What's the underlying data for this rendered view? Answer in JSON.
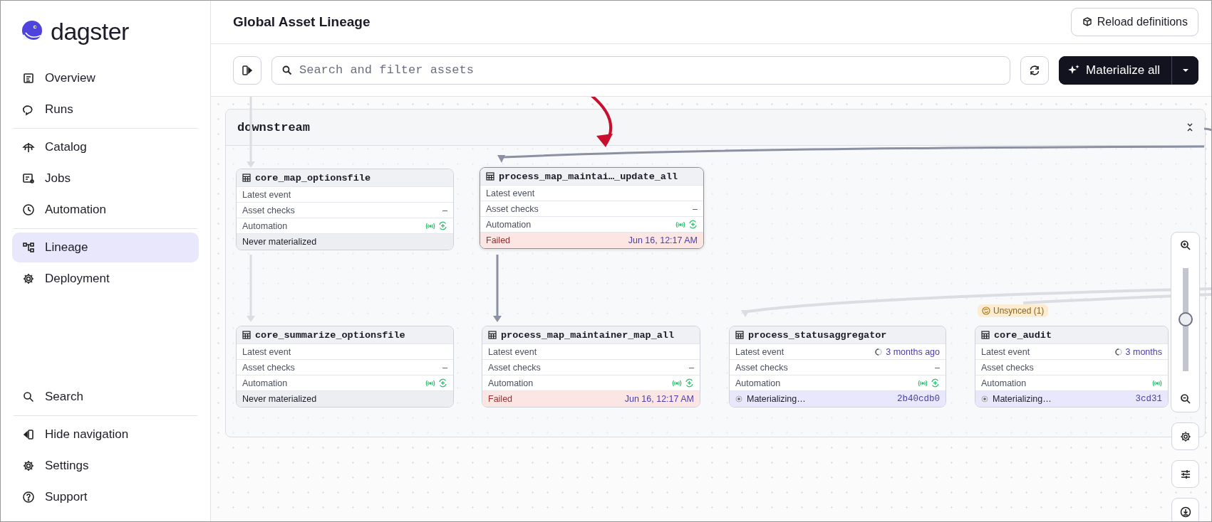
{
  "sidebar": {
    "logo": "dagster",
    "groups": [
      [
        {
          "label": "Overview",
          "selected": false
        },
        {
          "label": "Runs",
          "selected": false
        }
      ],
      [
        {
          "label": "Catalog",
          "selected": false
        },
        {
          "label": "Jobs",
          "selected": false
        },
        {
          "label": "Automation",
          "selected": false
        }
      ],
      [
        {
          "label": "Lineage",
          "selected": true
        },
        {
          "label": "Deployment",
          "selected": false
        }
      ]
    ],
    "bottom_groups": [
      [
        {
          "label": "Search",
          "selected": false
        }
      ],
      [
        {
          "label": "Hide navigation",
          "selected": false
        },
        {
          "label": "Settings",
          "selected": false
        },
        {
          "label": "Support",
          "selected": false
        }
      ]
    ]
  },
  "header": {
    "title": "Global Asset Lineage",
    "reload_button": "Reload definitions"
  },
  "toolbar": {
    "search": {
      "placeholder": "Search and filter assets"
    },
    "materialize_button": "Materialize all"
  },
  "group": {
    "title": "downstream"
  },
  "nodes": [
    {
      "name": "core_map_optionsfile",
      "selected": false,
      "rows": [
        {
          "kind": "event",
          "label": "Latest event"
        },
        {
          "kind": "checks",
          "label": "Asset checks",
          "value": "–"
        },
        {
          "kind": "automation",
          "label": "Automation",
          "icons": [
            {
              "kind": "sensor"
            },
            {
              "kind": "schedule"
            }
          ]
        }
      ],
      "status": {
        "kind": "never",
        "text": "Never materialized"
      }
    },
    {
      "name": "process_map_maintai…_update_all",
      "selected": true,
      "rows": [
        {
          "kind": "event",
          "label": "Latest event"
        },
        {
          "kind": "checks",
          "label": "Asset checks",
          "value": "–"
        },
        {
          "kind": "automation",
          "label": "Automation",
          "icons": [
            {
              "kind": "sensor"
            },
            {
              "kind": "schedule"
            }
          ]
        }
      ],
      "status": {
        "kind": "failed",
        "text": "Failed",
        "value": "Jun 16, 12:17 AM"
      }
    },
    {
      "name": "core_summarize_optionsfile",
      "selected": false,
      "rows": [
        {
          "kind": "event",
          "label": "Latest event"
        },
        {
          "kind": "checks",
          "label": "Asset checks",
          "value": "–"
        },
        {
          "kind": "automation",
          "label": "Automation",
          "icons": [
            {
              "kind": "sensor"
            },
            {
              "kind": "schedule"
            }
          ]
        }
      ],
      "status": {
        "kind": "never",
        "text": "Never materialized"
      }
    },
    {
      "name": "process_map_maintainer_map_all",
      "selected": false,
      "rows": [
        {
          "kind": "event",
          "label": "Latest event"
        },
        {
          "kind": "checks",
          "label": "Asset checks",
          "value": "–"
        },
        {
          "kind": "automation",
          "label": "Automation",
          "icons": [
            {
              "kind": "sensor"
            },
            {
              "kind": "schedule"
            }
          ]
        }
      ],
      "status": {
        "kind": "failed",
        "text": "Failed",
        "value": "Jun 16, 12:17 AM"
      }
    },
    {
      "name": "process_statusaggregator",
      "selected": false,
      "rows": [
        {
          "kind": "event",
          "label": "Latest event",
          "value": "3 months ago"
        },
        {
          "kind": "checks",
          "label": "Asset checks",
          "value": "–"
        },
        {
          "kind": "automation",
          "label": "Automation",
          "icons": [
            {
              "kind": "sensor"
            },
            {
              "kind": "schedule"
            }
          ]
        }
      ],
      "status": {
        "kind": "materializing",
        "text": "Materializing…",
        "value": "2b40cdb0"
      }
    },
    {
      "name": "core_audit",
      "selected": false,
      "badge": "Unsynced (1)",
      "rows": [
        {
          "kind": "event",
          "label": "Latest event",
          "value": "3 months"
        },
        {
          "kind": "checks",
          "label": "Asset checks"
        },
        {
          "kind": "automation",
          "label": "Automation",
          "icons": [
            {
              "kind": "sensor"
            }
          ]
        }
      ],
      "status": {
        "kind": "materializing",
        "text": "Materializing…",
        "value": "3cd31"
      }
    }
  ],
  "zoom_slider": {
    "level": 0.5
  }
}
